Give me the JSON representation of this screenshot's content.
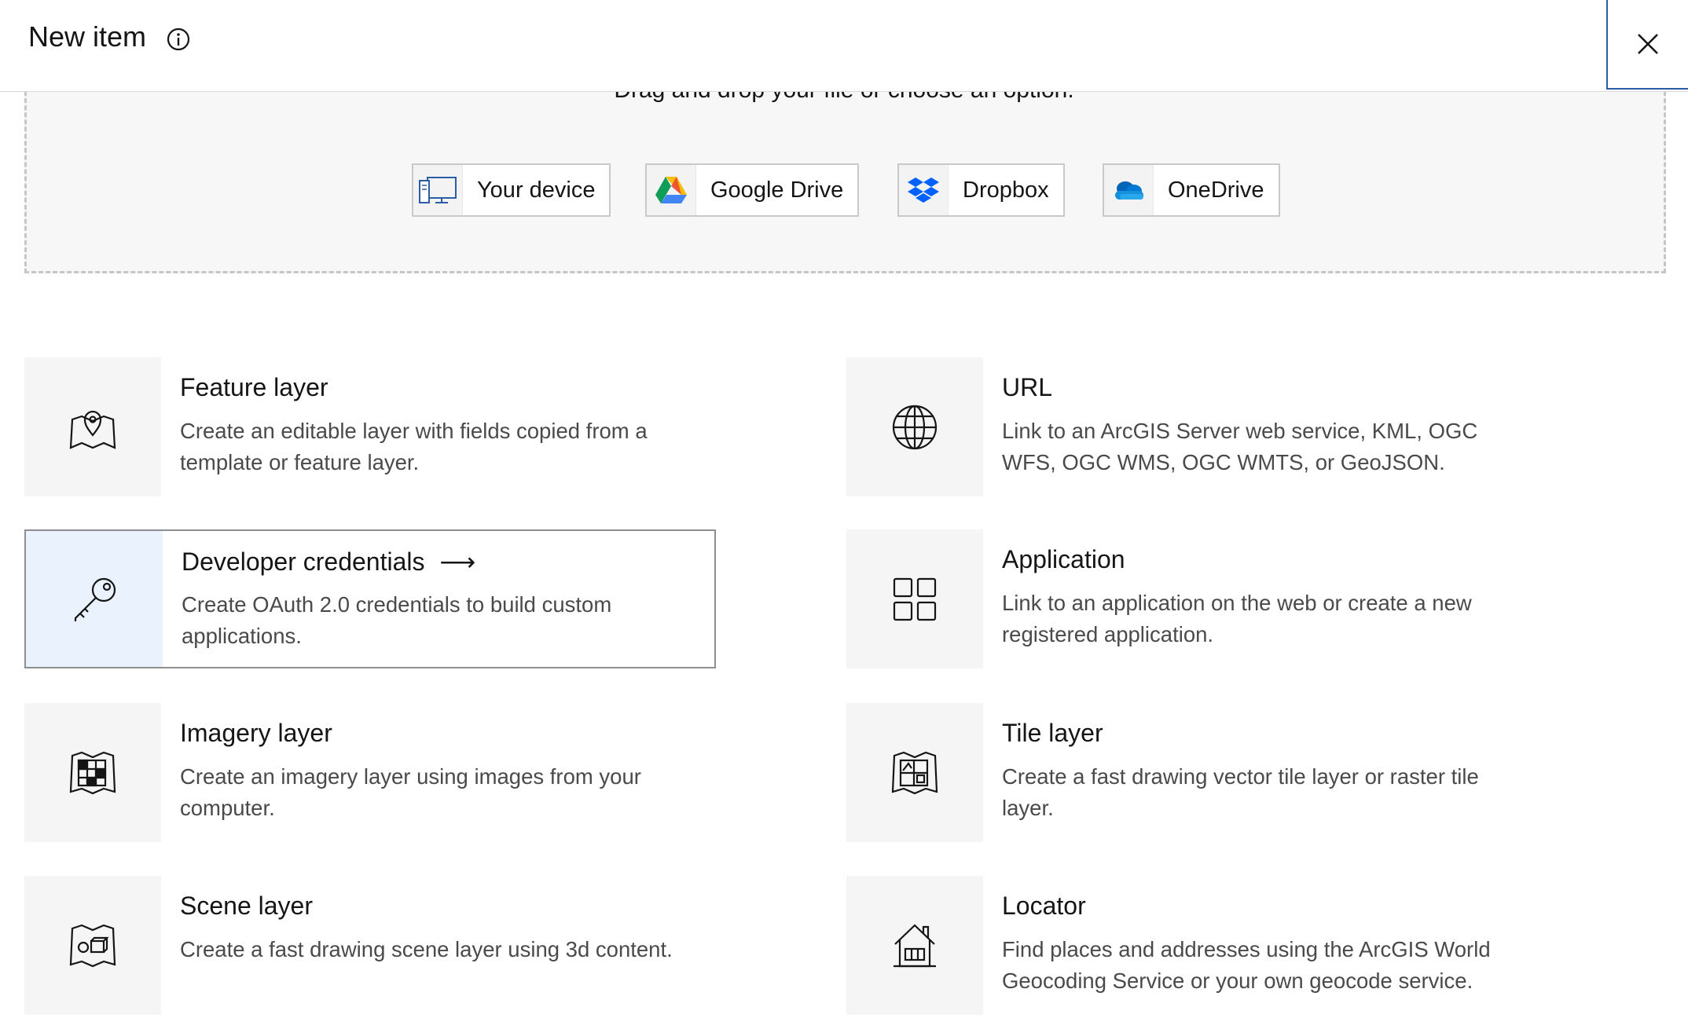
{
  "header": {
    "title": "New item",
    "info_icon": "info-icon",
    "close_icon": "close-icon"
  },
  "dropzone": {
    "instruction": "Drag and drop your file or choose an option.",
    "sources": [
      {
        "label": "Your device",
        "icon": "device-icon"
      },
      {
        "label": "Google Drive",
        "icon": "google-drive-icon"
      },
      {
        "label": "Dropbox",
        "icon": "dropbox-icon"
      },
      {
        "label": "OneDrive",
        "icon": "onedrive-icon"
      }
    ]
  },
  "items": [
    {
      "title": "Feature layer",
      "description": "Create an editable layer with fields copied from a template or feature layer.",
      "icon": "map-pin-icon"
    },
    {
      "title": "URL",
      "description": "Link to an ArcGIS Server web service, KML, OGC WFS, OGC WMS, OGC WMTS, or GeoJSON.",
      "icon": "globe-icon"
    },
    {
      "title": "Developer credentials",
      "arrow": "⟶",
      "description": "Create OAuth 2.0 credentials to build custom applications.",
      "icon": "key-icon",
      "selected": true
    },
    {
      "title": "Application",
      "description": "Link to an application on the web or create a new registered application.",
      "icon": "grid-icon"
    },
    {
      "title": "Imagery layer",
      "description": "Create an imagery layer using images from your computer.",
      "icon": "imagery-icon"
    },
    {
      "title": "Tile layer",
      "description": "Create a fast drawing vector tile layer or raster tile layer.",
      "icon": "tile-icon"
    },
    {
      "title": "Scene layer",
      "description": "Create a fast drawing scene layer using 3d content.",
      "icon": "scene-icon"
    },
    {
      "title": "Locator",
      "description": "Find places and addresses using the ArcGIS World Geocoding Service or your own geocode service.",
      "icon": "house-icon"
    }
  ],
  "colors": {
    "accent": "#2b5da4",
    "selected_icon_bg": "#eaf3fd",
    "card_icon_bg": "#f5f5f5"
  }
}
